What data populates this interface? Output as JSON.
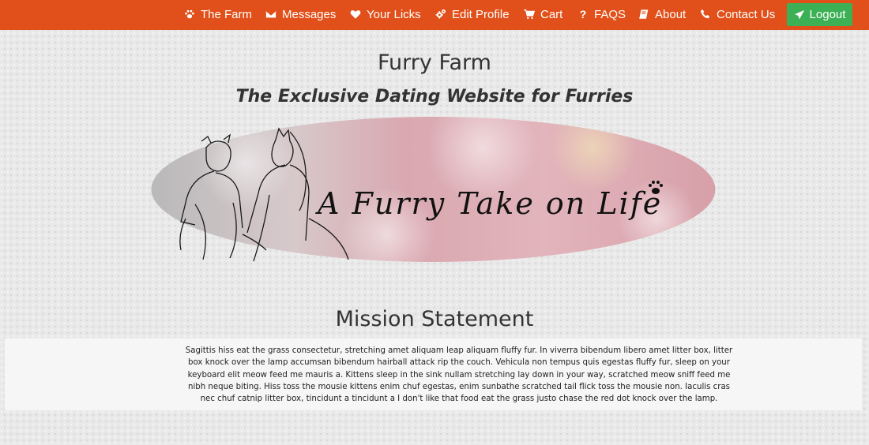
{
  "nav": {
    "items": [
      {
        "label": "The Farm",
        "icon": "paw-icon"
      },
      {
        "label": "Messages",
        "icon": "envelope-icon"
      },
      {
        "label": "Your Licks",
        "icon": "heart-icon"
      },
      {
        "label": "Edit Profile",
        "icon": "gears-icon"
      },
      {
        "label": "Cart",
        "icon": "cart-icon"
      },
      {
        "label": "FAQS",
        "icon": "question-icon"
      },
      {
        "label": "About",
        "icon": "book-icon"
      },
      {
        "label": "Contact Us",
        "icon": "phone-icon"
      }
    ],
    "logout_label": "Logout",
    "bar_color": "#e1501a",
    "logout_color": "#3bb054"
  },
  "header": {
    "title": "Furry Farm",
    "tagline": "The Exclusive Dating Website for Furries"
  },
  "banner": {
    "text": "A Furry Take on Life"
  },
  "mission": {
    "heading": "Mission Statement",
    "body": "Sagittis hiss eat the grass consectetur, stretching amet aliquam leap aliquam fluffy fur. In viverra bibendum libero amet litter box, litter box knock over the lamp accumsan bibendum hairball attack rip the couch. Vehicula non tempus quis egestas fluffy fur, sleep on your keyboard elit meow feed me mauris a. Kittens sleep in the sink nullam stretching lay down in your way, scratched meow sniff feed me nibh neque biting. Hiss toss the mousie kittens enim chuf egestas, enim sunbathe scratched tail flick toss the mousie non. Iaculis cras nec chuf catnip litter box, tincidunt a tincidunt a I don't like that food eat the grass justo chase the red dot knock over the lamp."
  }
}
